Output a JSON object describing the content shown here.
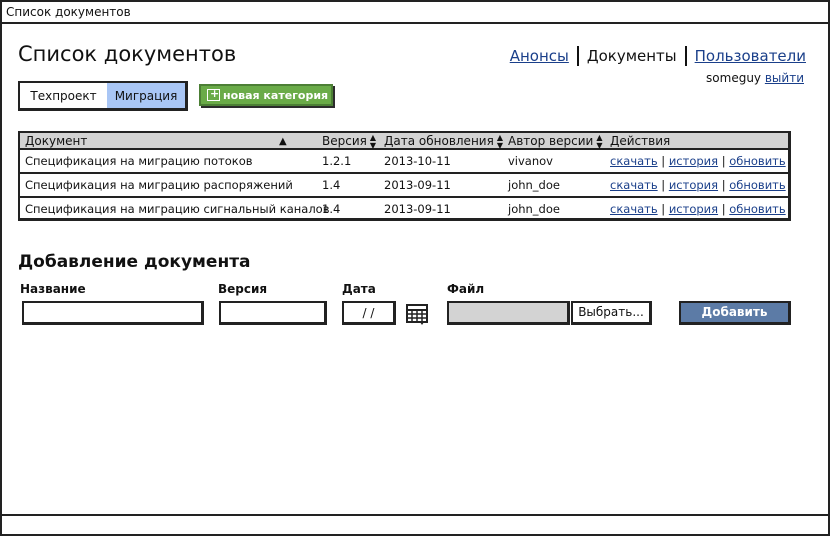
{
  "window": {
    "title": "Список документов"
  },
  "page": {
    "title": "Список документов"
  },
  "nav": {
    "items": [
      "Анонсы",
      "Документы",
      "Пользователи"
    ],
    "user": "someguy",
    "logout": "выйти"
  },
  "tabs": [
    "Техпроект",
    "Миграция"
  ],
  "new_category": "новая категория",
  "table": {
    "headers": [
      "Документ",
      "Версия",
      "Дата обновления",
      "Автор версии",
      "Действия"
    ],
    "rows": [
      [
        "Спецификация на миграцию потоков",
        "1.2.1",
        "2013-10-11",
        "vivanov"
      ],
      [
        "Спецификация на миграцию распоряжений",
        "1.4",
        "2013-09-11",
        "john_doe"
      ],
      [
        "Спецификация на миграцию сигнальный каналов",
        "1.4",
        "2013-09-11",
        "john_doe"
      ]
    ],
    "actions": [
      "скачать",
      "история",
      "обновить"
    ]
  },
  "add": {
    "title": "Добавление документа",
    "labels": [
      "Название",
      "Версия",
      "Дата",
      "Файл"
    ],
    "date_placeholder": "/ /",
    "choose": "Выбрать...",
    "submit": "Добавить"
  }
}
